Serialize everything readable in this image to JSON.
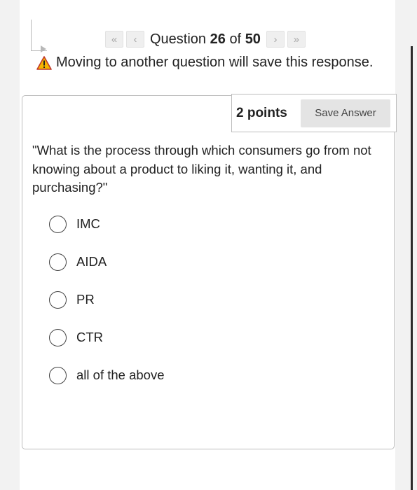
{
  "navigation": {
    "first_icon": "double-chevron-left-icon",
    "prev_icon": "chevron-left-icon",
    "next_icon": "chevron-right-icon",
    "last_icon": "double-chevron-right-icon",
    "question_word": "Question",
    "current": "26",
    "of_word": "of",
    "total": "50"
  },
  "warning": {
    "icon": "warning-triangle-icon",
    "text": "Moving to another question will save this response."
  },
  "question": {
    "points": "2 points",
    "save_label": "Save Answer",
    "text": "\"What is the process through which consumers go from not knowing about a product to liking it, wanting it, and purchasing?\"",
    "options": [
      "IMC",
      "AIDA",
      "PR",
      "CTR",
      "all of the above"
    ]
  },
  "colors": {
    "warning_yellow": "#f5b400",
    "warning_border": "#c0392b",
    "button_bg": "#e4e4e4"
  }
}
